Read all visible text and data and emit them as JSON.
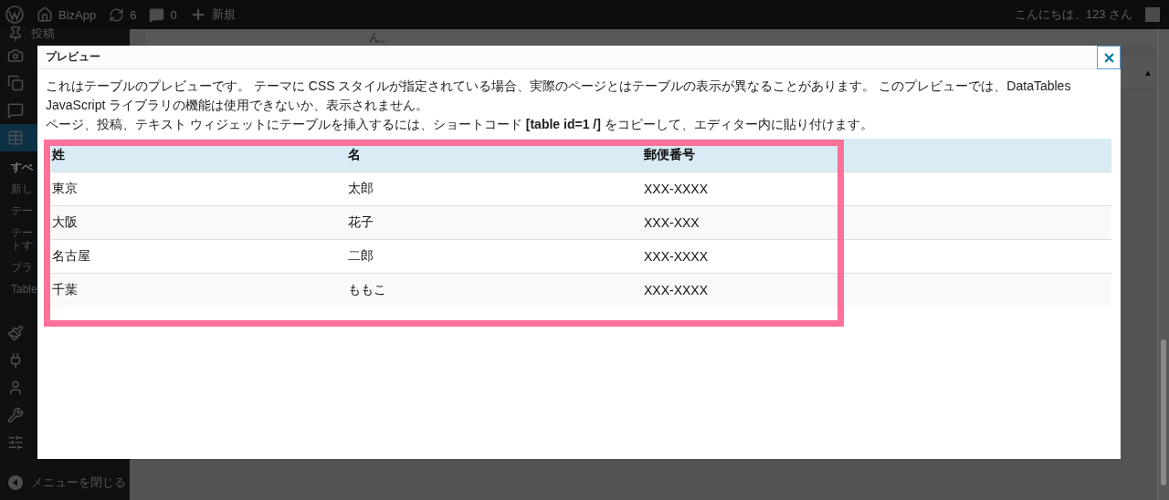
{
  "admin_bar": {
    "site_name": "BizApp",
    "updates": "6",
    "comments": "0",
    "new_label": "新規",
    "greeting": "こんにちは、123 さん"
  },
  "sidebar": {
    "items": [
      {
        "kind": "menu",
        "label": "投稿",
        "selected": false
      },
      {
        "kind": "menu",
        "selected": false
      },
      {
        "kind": "menu",
        "selected": false
      },
      {
        "kind": "menu",
        "selected": false
      },
      {
        "kind": "menu",
        "selected": true,
        "children": [
          {
            "label": "すべ",
            "selected": true
          },
          {
            "label": "新し",
            "selected": false
          },
          {
            "label": "テー",
            "selected": false
          },
          {
            "label": "テートす",
            "selected": false
          },
          {
            "label": "プラ",
            "selected": false
          },
          {
            "label": "Table",
            "selected": false
          }
        ]
      },
      {
        "kind": "menu",
        "selected": false
      },
      {
        "kind": "menu",
        "selected": false
      },
      {
        "kind": "menu",
        "selected": false
      },
      {
        "kind": "menu",
        "selected": false
      },
      {
        "kind": "menu",
        "selected": false
      },
      {
        "kind": "collapse",
        "label": "メニューを閉じる",
        "selected": false
      }
    ]
  },
  "content": {
    "text": "ん。",
    "sort_mark": "▲"
  },
  "modal": {
    "title": "プレビュー",
    "paragraphs": [
      "これはテーブルのプレビューです。 テーマに CSS スタイルが指定されている場合、実際のページとはテーブルの表示が異なることがあります。 このプレビューでは、DataTables JavaScript ライブラリの機能は使用できないか、表示されません。",
      "ページ、投稿、テキスト ウィジェットにテーブルを挿入するには、ショートコード **[table id=1 /]** をコピーして、エディター内に貼り付けます。"
    ],
    "table": {
      "columns": [
        "姓",
        "名",
        "郵便番号"
      ],
      "rows": [
        [
          "東京",
          "太郎",
          "XXX-XXXX"
        ],
        [
          "大阪",
          "花子",
          "XXX-XXX"
        ],
        [
          "名古屋",
          "二郎",
          "XXX-XXXX"
        ],
        [
          "千葉",
          "ももこ",
          "XXX-XXXX"
        ]
      ]
    }
  }
}
